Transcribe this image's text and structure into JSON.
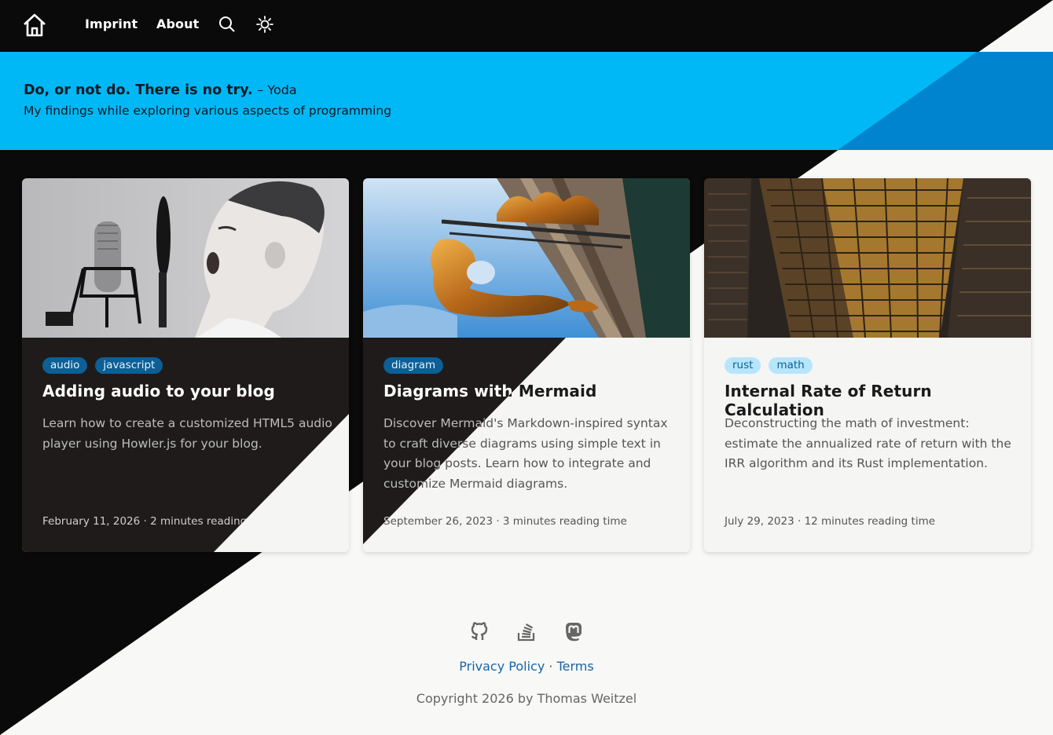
{
  "nav": {
    "home_icon": "home-icon",
    "links": [
      "Imprint",
      "About"
    ],
    "search_icon": "search-icon",
    "theme_icon": "sun-icon"
  },
  "hero": {
    "quote": "Do, or not do. There is no try.",
    "author": "– Yoda",
    "subtitle": "My findings while exploring various aspects of programming",
    "colors": {
      "band": "#00b8f5",
      "band_dark": "#0184cf"
    }
  },
  "posts": [
    {
      "tags": [
        "audio",
        "javascript"
      ],
      "title": "Adding audio to your blog",
      "description": "Learn how to create a customized HTML5 audio player using Howler.js for your blog.",
      "date": "February 11, 2026",
      "reading_time": "2 minutes reading time",
      "image": "boy shouting into a studio microphone"
    },
    {
      "tags": [
        "diagram"
      ],
      "title": "Diagrams with Mermaid",
      "description": "Discover Mermaid's Markdown-inspired syntax to craft diverse diagrams using simple text in your blog posts. Learn how to integrate and customize Mermaid diagrams.",
      "date": "September 26, 2023",
      "reading_time": "3 minutes reading time",
      "image": "golden mermaid sign on a building"
    },
    {
      "tags": [
        "rust",
        "math"
      ],
      "title": "Internal Rate of Return Calculation",
      "description": "Deconstructing the math of investment: estimate the annualized rate of return with the IRR algorithm and its Rust implementation.",
      "date": "July 29, 2023",
      "reading_time": "12 minutes reading time",
      "image": "lit office skyscraper at night"
    }
  ],
  "footer": {
    "social_icons": [
      "github-icon",
      "stackoverflow-icon",
      "mastodon-icon"
    ],
    "privacy": "Privacy Policy",
    "separator": "·",
    "terms": "Terms",
    "copyright": "Copyright 2026 by Thomas Weitzel"
  }
}
